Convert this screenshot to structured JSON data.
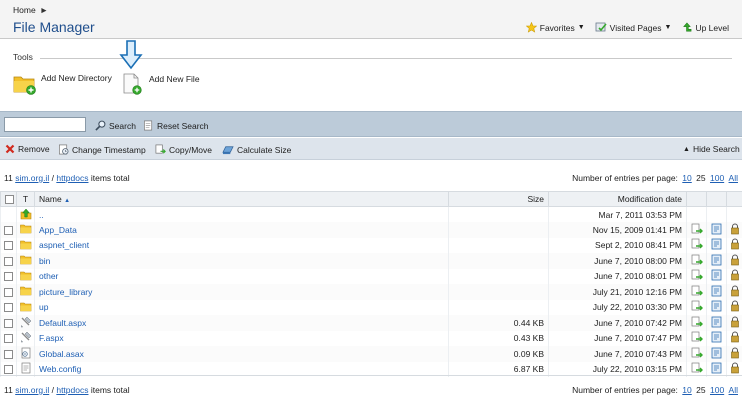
{
  "breadcrumb": {
    "home": "Home"
  },
  "header": {
    "title": "File Manager",
    "favorites": "Favorites",
    "visited": "Visited Pages",
    "uplevel": "Up Level"
  },
  "tools": {
    "label": "Tools",
    "add_dir": "Add New Directory",
    "add_file": "Add New File"
  },
  "search": {
    "value": "",
    "search_btn": "Search",
    "reset_btn": "Reset Search"
  },
  "actions": {
    "remove": "Remove",
    "timestamp": "Change Timestamp",
    "copymove": "Copy/Move",
    "calcsize": "Calculate Size",
    "hide_search": "Hide Search"
  },
  "info": {
    "count": "11",
    "path1": "sim.org.il",
    "sep": "/",
    "path2": "httpdocs",
    "suffix": "items total",
    "perpage_label": "Number of entries per page:",
    "perpage_options": [
      "10",
      "25",
      "100",
      "All"
    ],
    "perpage_selected": "25"
  },
  "table": {
    "headers": {
      "type": "T",
      "name": "Name",
      "size": "Size",
      "date": "Modification date"
    },
    "rows": [
      {
        "icon": "up",
        "name": "..",
        "size": "",
        "date": "Mar 7, 2011 03:53 PM",
        "actions": false
      },
      {
        "icon": "folder",
        "name": "App_Data",
        "size": "",
        "date": "Nov 15, 2009 01:41 PM",
        "actions": true
      },
      {
        "icon": "folder",
        "name": "aspnet_client",
        "size": "",
        "date": "Sept 2, 2010 08:41 PM",
        "actions": true
      },
      {
        "icon": "folder",
        "name": "bin",
        "size": "",
        "date": "June 7, 2010 08:00 PM",
        "actions": true
      },
      {
        "icon": "folder",
        "name": "other",
        "size": "",
        "date": "June 7, 2010 08:01 PM",
        "actions": true
      },
      {
        "icon": "folder",
        "name": "picture_library",
        "size": "",
        "date": "July 21, 2010 12:16 PM",
        "actions": true
      },
      {
        "icon": "folder",
        "name": "up",
        "size": "",
        "date": "July 22, 2010 03:30 PM",
        "actions": true
      },
      {
        "icon": "aspx",
        "name": "Default.aspx",
        "size": "0.44 KB",
        "date": "June 7, 2010 07:42 PM",
        "actions": true
      },
      {
        "icon": "aspx",
        "name": "F.aspx",
        "size": "0.43 KB",
        "date": "June 7, 2010 07:47 PM",
        "actions": true
      },
      {
        "icon": "asax",
        "name": "Global.asax",
        "size": "0.09 KB",
        "date": "June 7, 2010 07:43 PM",
        "actions": true
      },
      {
        "icon": "config",
        "name": "Web.config",
        "size": "6.87 KB",
        "date": "July 22, 2010 03:15 PM",
        "actions": true
      }
    ]
  },
  "colors": {
    "link": "#1e5fb4",
    "title": "#1f4e8c",
    "folder": "#f2c02a",
    "green": "#35a82c"
  }
}
